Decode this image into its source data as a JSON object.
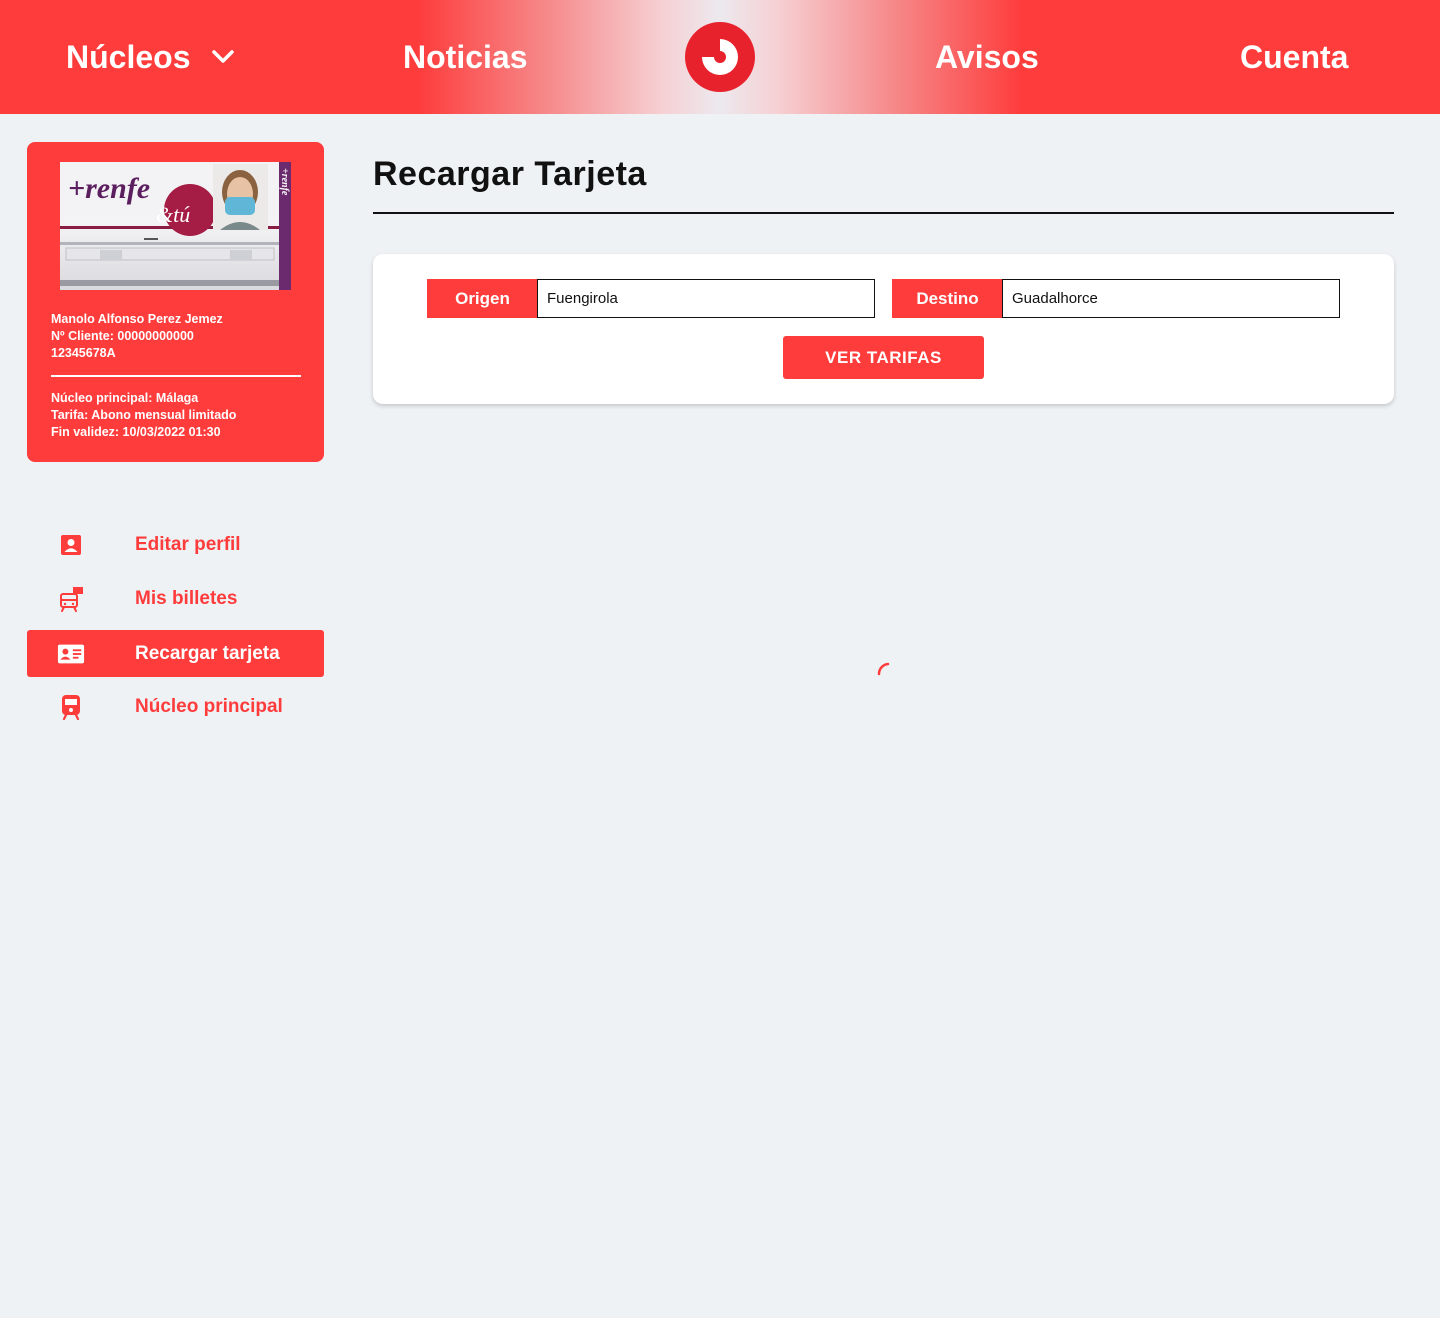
{
  "colors": {
    "brand": "#fe3c3c",
    "background": "#eff2f5",
    "text_dark": "#111111"
  },
  "header": {
    "nav": {
      "nucleos": "Núcleos",
      "noticias": "Noticias",
      "avisos": "Avisos",
      "cuenta": "Cuenta"
    },
    "logo_icon": "renfe-logo-icon",
    "dropdown_icon": "chevron-down-icon"
  },
  "profile": {
    "name": "Manolo Alfonso Perez Jemez",
    "client_number": "Nº Cliente: 00000000000",
    "id_document": "12345678A",
    "nucleo": "Núcleo principal: Málaga",
    "tarifa": "Tarifa: Abono mensual limitado",
    "validity": "Fin validez: 10/03/2022 01:30",
    "card_logo_text": "+renfe",
    "card_logo_sub": "&tú",
    "card_side_text": "+renfe"
  },
  "sidebar": {
    "items": [
      {
        "label": "Editar perfil",
        "icon": "user-profile-icon",
        "active": false
      },
      {
        "label": "Mis billetes",
        "icon": "train-ticket-icon",
        "active": false
      },
      {
        "label": "Recargar tarjeta",
        "icon": "id-card-icon",
        "active": true
      },
      {
        "label": "Núcleo principal",
        "icon": "train-icon",
        "active": false
      }
    ]
  },
  "main": {
    "title": "Recargar Tarjeta",
    "form": {
      "origen_label": "Origen",
      "origen_value": "Fuengirola",
      "destino_label": "Destino",
      "destino_value": "Guadalhorce",
      "submit_label": "VER TARIFAS"
    },
    "loading_icon": "loading-spinner-icon"
  }
}
